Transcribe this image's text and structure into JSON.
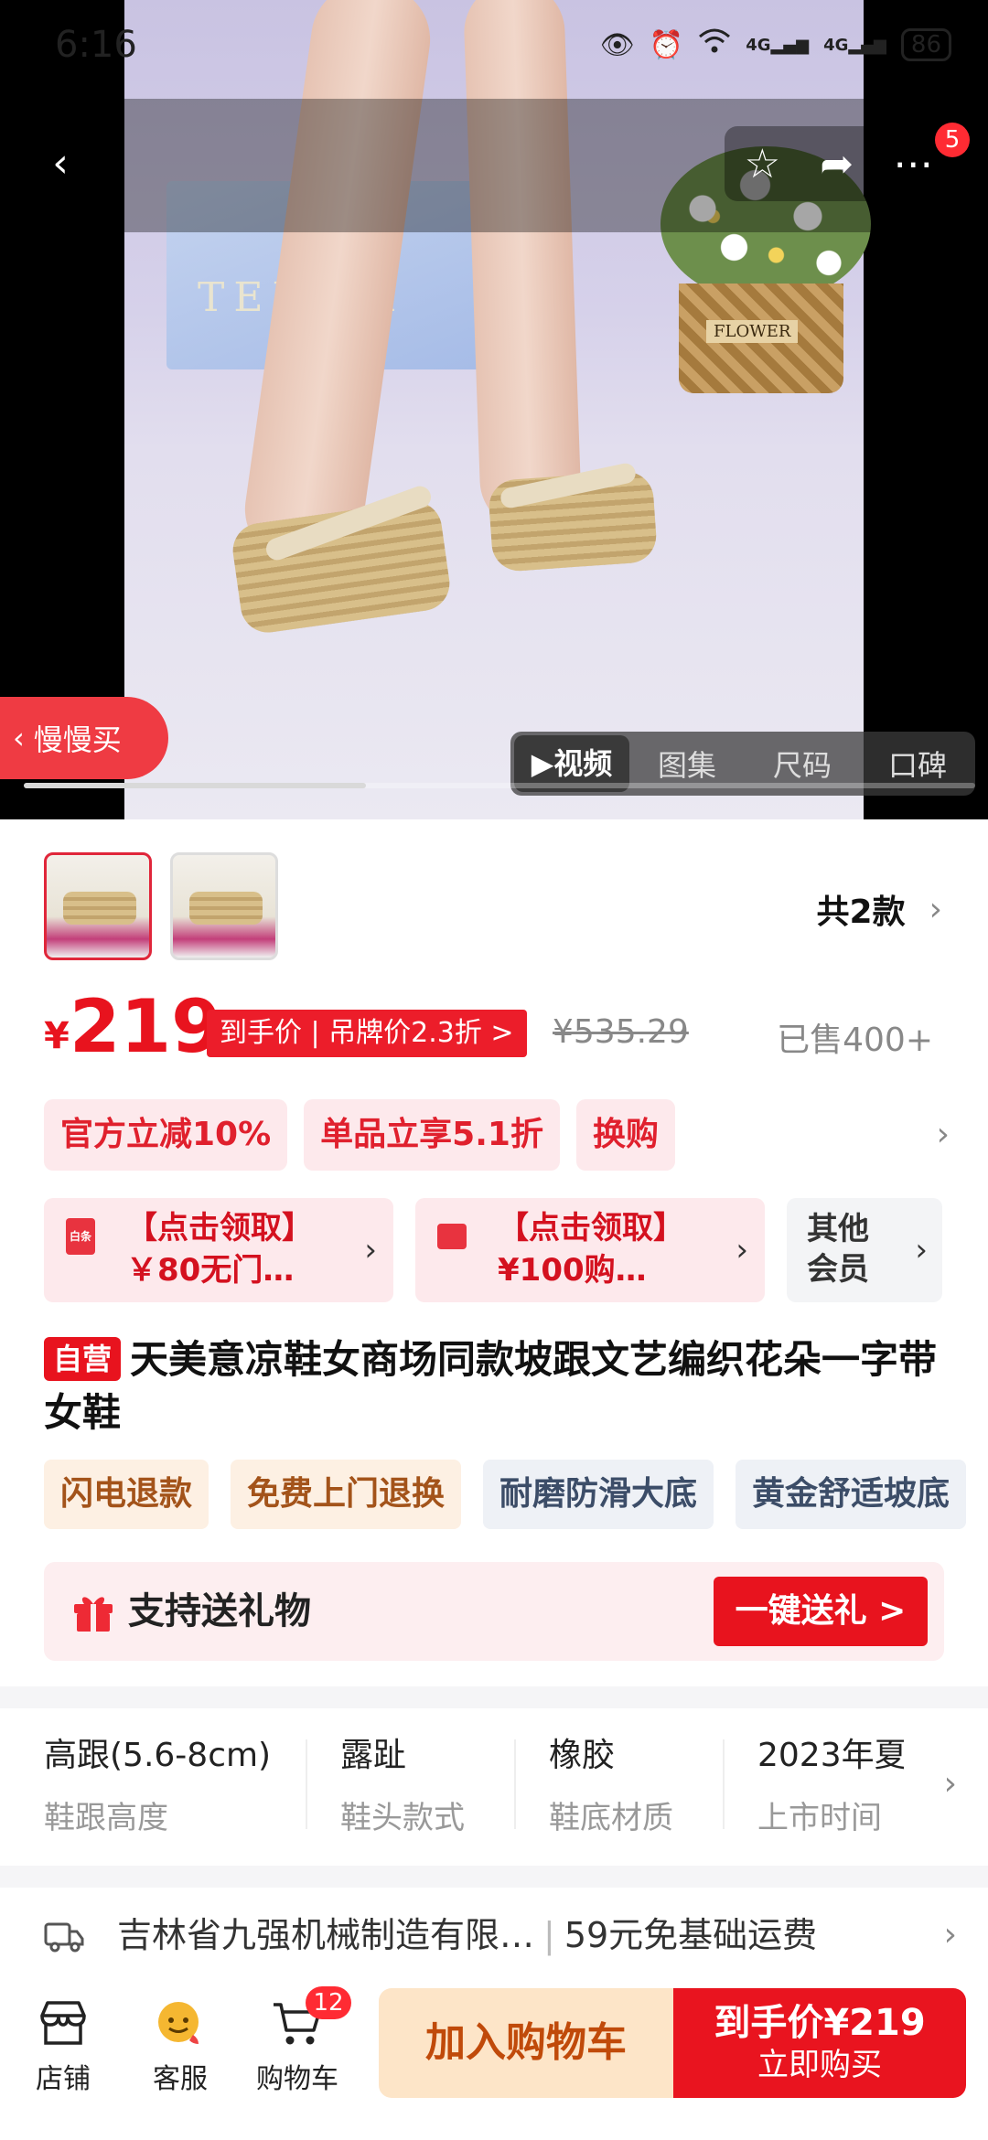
{
  "status_bar": {
    "time": "6:16",
    "network1": "4G",
    "network2": "4G",
    "battery": "86"
  },
  "header": {
    "notification_count": "5"
  },
  "hero": {
    "slow_buy_label": "慢慢买",
    "box_brand": "TEENM",
    "basket_tag": "FLOWER",
    "media_tabs": [
      {
        "label": "视频",
        "active": true
      },
      {
        "label": "图集"
      },
      {
        "label": "尺码"
      },
      {
        "label": "口碑"
      }
    ],
    "progress": 0.36
  },
  "variants": {
    "count_label": "共2款",
    "selected_index": 0
  },
  "price": {
    "currency": "¥",
    "amount": "219",
    "tag": "到手价 | 吊牌价2.3折 >",
    "original": "¥535.29",
    "sold": "已售400+"
  },
  "promos": [
    "官方立减10%",
    "单品立享5.1折",
    "换购"
  ],
  "coupons": [
    {
      "text": "【点击领取】￥80无门…",
      "icon_text": "白条"
    },
    {
      "text": "【点击领取】¥100购…",
      "icon_text": ""
    }
  ],
  "coupon_other": "其他会员",
  "product": {
    "badge": "自营",
    "title": "天美意凉鞋女商场同款坡跟文艺编织花朵一字带女鞋"
  },
  "features": [
    "闪电退款",
    "免费上门退换",
    "耐磨防滑大底",
    "黄金舒适坡底"
  ],
  "gift": {
    "text": "支持送礼物",
    "button": "一键送礼 >"
  },
  "specs": [
    {
      "value": "高跟(5.6-8cm)",
      "key": "鞋跟高度"
    },
    {
      "value": "露趾",
      "key": "鞋头款式"
    },
    {
      "value": "橡胶",
      "key": "鞋底材质"
    },
    {
      "value": "2023年夏",
      "key": "上市时间"
    }
  ],
  "shipping": {
    "from": "吉林省九强机械制造有限…",
    "divider": "|",
    "fee": "59元免基础运费"
  },
  "bottom_bar": {
    "store": "店铺",
    "service": "客服",
    "cart": "购物车",
    "cart_count": "12",
    "add_cart": "加入购物车",
    "buy_price": "到手价¥219",
    "buy_label": "立即购买"
  },
  "colors": {
    "accent": "#e8131e",
    "promo_bg": "#fde9ec",
    "add_cart_bg": "#fde5c8"
  }
}
